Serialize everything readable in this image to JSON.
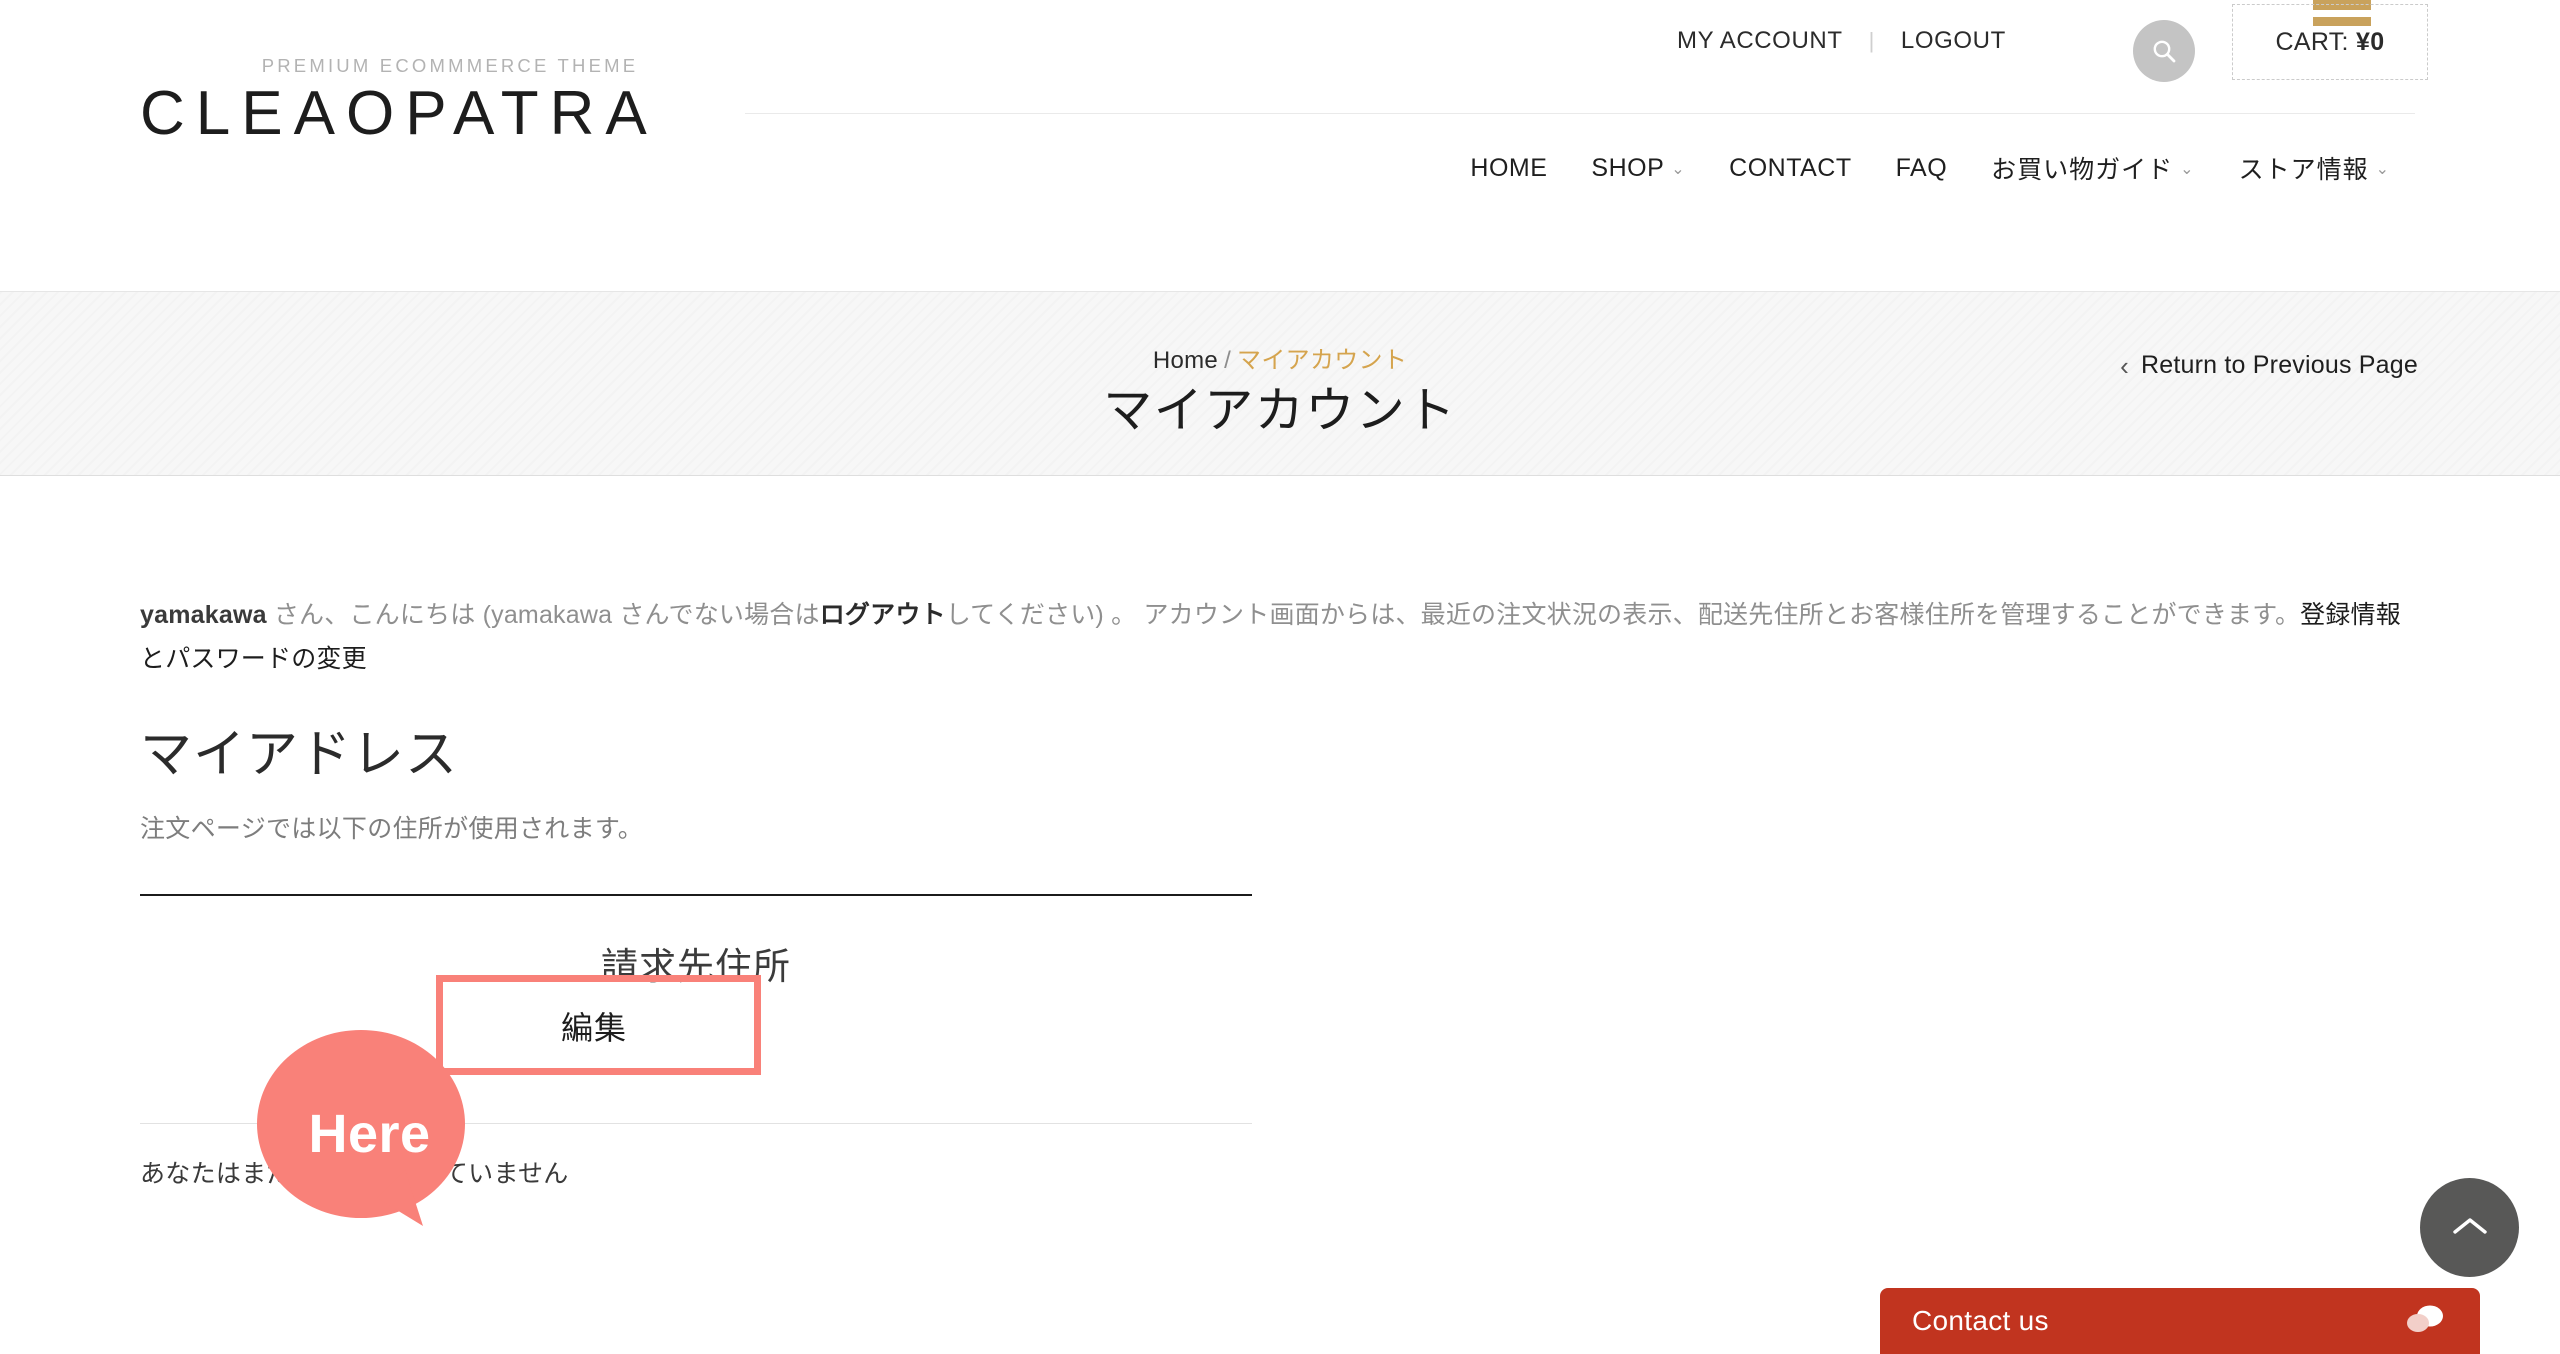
{
  "header": {
    "logo": {
      "tagline": "PREMIUM ECOMMMERCE THEME",
      "name": "CLEAOPATRA"
    },
    "utility": {
      "my_account": "MY ACCOUNT",
      "logout": "LOGOUT",
      "separator": "|",
      "search_icon": "search-icon",
      "cart_icon": "cart-icon",
      "cart_label_prefix": "CART: ",
      "cart_amount": "¥0"
    },
    "nav": [
      {
        "label": "HOME",
        "has_dropdown": false
      },
      {
        "label": "SHOP",
        "has_dropdown": true
      },
      {
        "label": "CONTACT",
        "has_dropdown": false
      },
      {
        "label": "FAQ",
        "has_dropdown": false
      },
      {
        "label": "お買い物ガイド",
        "has_dropdown": true
      },
      {
        "label": "ストア情報",
        "has_dropdown": true
      }
    ],
    "caret_glyph": "⌄"
  },
  "banner": {
    "breadcrumb": {
      "home": "Home",
      "separator": "/",
      "current": "マイアカウント"
    },
    "title": "マイアカウント",
    "return_link": {
      "chevron": "‹",
      "label": "Return to Previous Page"
    }
  },
  "main": {
    "greeting": {
      "user": "yamakawa",
      "part1": " さん、こんにちは (yamakawa さんでない場合は",
      "logout_link": "ログアウト",
      "part2": "してください) 。 アカウント画面からは、最近の注文状況の表示、配送先住所とお客様住所を管理することができます。",
      "edit_account_link": "登録情報とパスワードの変更"
    },
    "address_heading": "マイアドレス",
    "address_sub": "注文ページでは以下の住所が使用されます。",
    "billing": {
      "title": "請求先住所",
      "edit_label": "編集"
    },
    "no_address_message": "あなたはまだ住所を設定していません"
  },
  "annotation": {
    "bubble_text": "Here",
    "bubble_color": "#f98179",
    "highlight_color": "#f98179"
  },
  "widgets": {
    "scroll_top_icon": "chevron-up-icon",
    "contact_label": "Contact us",
    "contact_icon": "chat-bubble-icon",
    "contact_color": "#c1341f"
  }
}
